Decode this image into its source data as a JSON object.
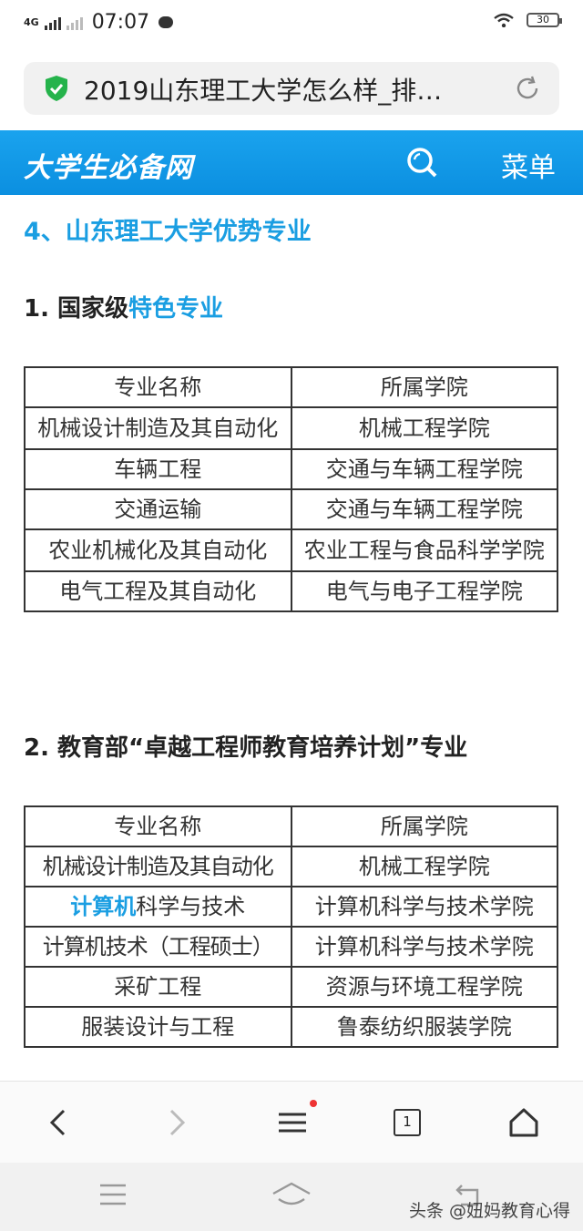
{
  "status": {
    "network": "4G",
    "time": "07:07",
    "battery": "30"
  },
  "browser": {
    "page_title": "2019山东理工大学怎么样_排…"
  },
  "site": {
    "logo": "大学生必备网",
    "menu_label": "菜单"
  },
  "content": {
    "section_title": "4、山东理工大学优势专业",
    "sub1_prefix": "1. 国家级",
    "sub1_highlight": "特色专业",
    "sub2_title": "2. 教育部“卓越工程师教育培养计划”专业",
    "table1": {
      "headers": [
        "专业名称",
        "所属学院"
      ],
      "rows": [
        [
          "机械设计制造及其自动化",
          "机械工程学院"
        ],
        [
          "车辆工程",
          "交通与车辆工程学院"
        ],
        [
          "交通运输",
          "交通与车辆工程学院"
        ],
        [
          "农业机械化及其自动化",
          "农业工程与食品科学学院"
        ],
        [
          "电气工程及其自动化",
          "电气与电子工程学院"
        ]
      ]
    },
    "table2": {
      "headers": [
        "专业名称",
        "所属学院"
      ],
      "rows": [
        [
          "机械设计制造及其自动化",
          "机械工程学院"
        ],
        [
          "科学与技术",
          "计算机科学与技术学院"
        ],
        [
          "计算机技术（工程硕士）",
          "计算机科学与技术学院"
        ],
        [
          "采矿工程",
          "资源与环境工程学院"
        ],
        [
          "服装设计与工程",
          "鲁泰纺织服装学院"
        ]
      ],
      "row2_highlight": "计算机"
    }
  },
  "toolbar": {
    "tabs_count": "1"
  },
  "watermark": "头条 @妞妈教育心得",
  "colors": {
    "accent": "#1a9ee2",
    "header_bg": "#0b8fe0"
  }
}
